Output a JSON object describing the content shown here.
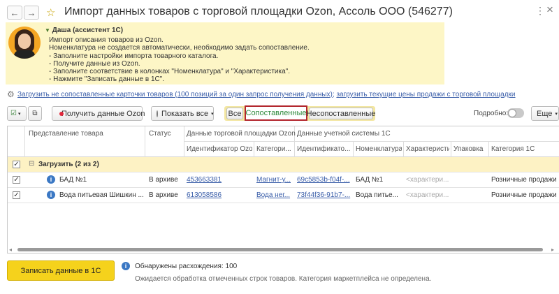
{
  "window": {
    "title": "Импорт данных товаров с торговой площадки Ozon, Ассоль ООО (546277)",
    "back_icon": "←",
    "forward_icon": "→",
    "menu_icon": "⋮",
    "close_icon": "×"
  },
  "assistant": {
    "name": "Даша (ассистент 1С)",
    "lines": [
      "Импорт описания товаров из Ozon.",
      "Номенклатура не создается автоматически, необходимо задать сопоставление.",
      "- Заполните настройки импорта товарного каталога.",
      "- Получите данные из Ozon.",
      "- Заполните соответствие в колонках \"Номенклатура\" и \"Характеристика\".",
      "- Нажмите \"Записать данные в 1С\"."
    ]
  },
  "links": {
    "upload_unmatched": "Загрузить не сопоставленные карточки товаров (100 позиций за один запрос получения данных)",
    "separator": ";",
    "load_prices": "загрузить текущие цены продажи с торговой площадки"
  },
  "toolbar": {
    "get_data": "Получить данные Ozon",
    "show_all": "Показать все",
    "filter_all": "Все",
    "filter_matched": "Сопоставленные",
    "filter_unmatched": "Несопоставленные",
    "detailed_label": "Подробно:",
    "more": "Еще"
  },
  "table": {
    "headers": {
      "product": "Представление товара",
      "status": "Статус",
      "marketplace_group": "Данные торговой площадки Ozon",
      "account_group": "Данные учетной системы 1С",
      "ozon_id": "Идентификатор Ozon",
      "category_short": "Категори...",
      "id_1c": "Идентификато...",
      "nomenclature": "Номенклатура",
      "characteristic": "Характеристи...",
      "package": "Упаковка",
      "category_1c": "Категория 1С"
    },
    "group_row": "Загрузить (2 из 2)",
    "rows": [
      {
        "product": "БАД №1",
        "status": "В архиве",
        "ozon_id": "453663381",
        "category": "Магнит-у...",
        "id_1c": "69c5853b-f04f-...",
        "nomenclature": "БАД №1",
        "characteristic": "<характери...",
        "category_1c": "Розничные продажи"
      },
      {
        "product": "Вода питьевая Шишкин ...",
        "status": "В архиве",
        "ozon_id": "613058586",
        "category": "Вода нег...",
        "id_1c": "73f44f36-91b7-...",
        "nomenclature": "Вода питье...",
        "characteristic": "<характери...",
        "category_1c": "Розничные продажи"
      }
    ]
  },
  "footer": {
    "write_button": "Записать данные в 1С",
    "discrepancies": "Обнаружены расхождения: 100",
    "pending": "Ожидается обработка отмеченных строк товаров. Категория маркетплейса не определена."
  },
  "colors": {
    "assistant_bg": "#fdf6c6",
    "group_row_bg": "#fdf2c4",
    "primary_button": "#f5d21c",
    "link": "#3a5ea9",
    "matched_filter_border": "#b3262d",
    "matched_text": "#2f8a3c"
  }
}
